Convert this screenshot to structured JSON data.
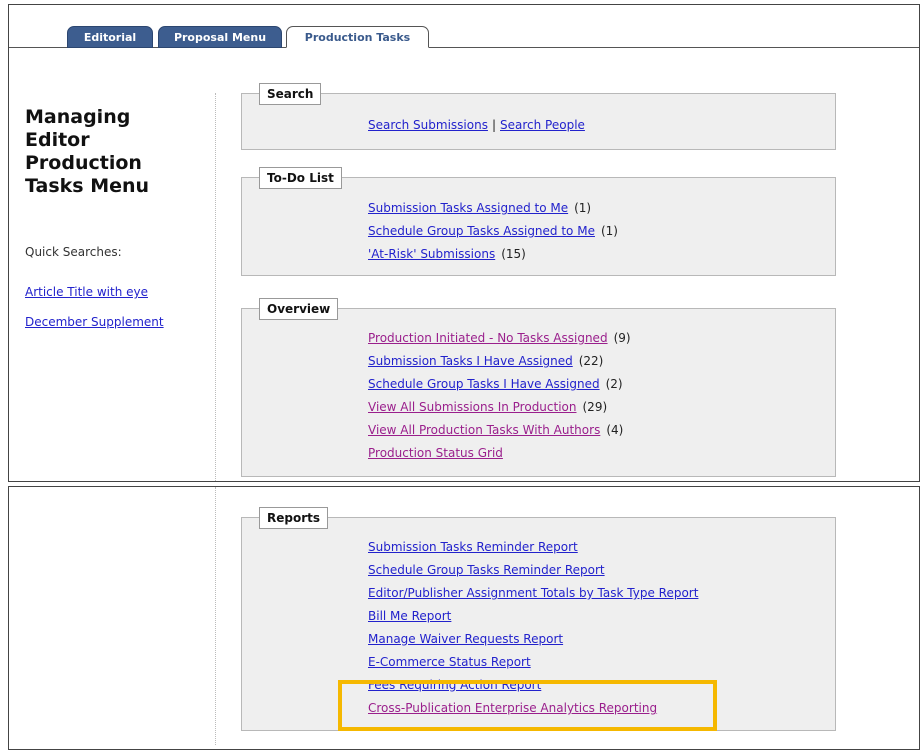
{
  "tabs": [
    {
      "label": "Editorial",
      "active": false
    },
    {
      "label": "Proposal Menu",
      "active": false
    },
    {
      "label": "Production Tasks",
      "active": true
    }
  ],
  "sidebar": {
    "title": "Managing Editor Production Tasks Menu",
    "quick_searches_label": "Quick Searches:",
    "links": [
      "Article Title with eye",
      "December Supplement"
    ]
  },
  "search": {
    "legend": "Search",
    "link1": "Search Submissions",
    "separator": "|",
    "link2": "Search People"
  },
  "todo": {
    "legend": "To-Do List",
    "items": [
      {
        "label": "Submission Tasks Assigned to Me",
        "count": "(1)"
      },
      {
        "label": "Schedule Group Tasks Assigned to Me",
        "count": "(1)"
      },
      {
        "label": "'At-Risk' Submissions",
        "count": "(15)"
      }
    ]
  },
  "overview": {
    "legend": "Overview",
    "items": [
      {
        "label": "Production Initiated - No Tasks Assigned",
        "count": "(9)"
      },
      {
        "label": "Submission Tasks I Have Assigned",
        "count": "(22)"
      },
      {
        "label": "Schedule Group Tasks I Have Assigned",
        "count": "(2)"
      },
      {
        "label": "View All Submissions In Production",
        "count": "(29)"
      },
      {
        "label": "View All Production Tasks With Authors",
        "count": "(4)"
      },
      {
        "label": "Production Status Grid",
        "count": ""
      }
    ]
  },
  "reports": {
    "legend": "Reports",
    "items": [
      "Submission Tasks Reminder Report",
      "Schedule Group Tasks Reminder Report",
      "Editor/Publisher Assignment Totals by Task Type Report",
      "Bill Me Report",
      "Manage Waiver Requests Report",
      "E-Commerce Status Report",
      "Fees Requiring Action Report",
      "Cross-Publication Enterprise Analytics Reporting"
    ]
  },
  "colors": {
    "tab_inactive": "#3d5d8f",
    "link": "#2222cc",
    "visited_link": "#9a1f8c",
    "highlight": "#f5b800",
    "group_background": "#efefef"
  }
}
